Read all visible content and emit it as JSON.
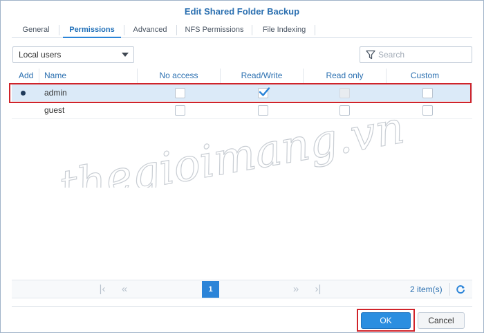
{
  "dialog": {
    "title": "Edit Shared Folder Backup"
  },
  "tabs": [
    {
      "label": "General",
      "active": false
    },
    {
      "label": "Permissions",
      "active": true
    },
    {
      "label": "Advanced",
      "active": false
    },
    {
      "label": "NFS Permissions",
      "active": false
    },
    {
      "label": "File Indexing",
      "active": false
    }
  ],
  "toolbar": {
    "user_type_selected": "Local users",
    "search_placeholder": "Search"
  },
  "table": {
    "columns": [
      "Add",
      "Name",
      "No access",
      "Read/Write",
      "Read only",
      "Custom"
    ],
    "rows": [
      {
        "name": "admin",
        "selected": true,
        "no_access": false,
        "read_write": true,
        "read_only": false,
        "read_only_disabled": true,
        "custom": false
      },
      {
        "name": "guest",
        "selected": false,
        "no_access": false,
        "read_write": false,
        "read_only": false,
        "read_only_disabled": false,
        "custom": false
      }
    ]
  },
  "pager": {
    "current_page": "1",
    "item_count": "2 item(s)"
  },
  "buttons": {
    "ok_label": "OK",
    "cancel_label": "Cancel"
  },
  "watermark": {
    "text": "thegioimang.vn"
  },
  "colors": {
    "accent": "#2b84d8",
    "title": "#2a6fb0",
    "selected_row": "#dbeaf8",
    "highlight": "#d0232a"
  }
}
